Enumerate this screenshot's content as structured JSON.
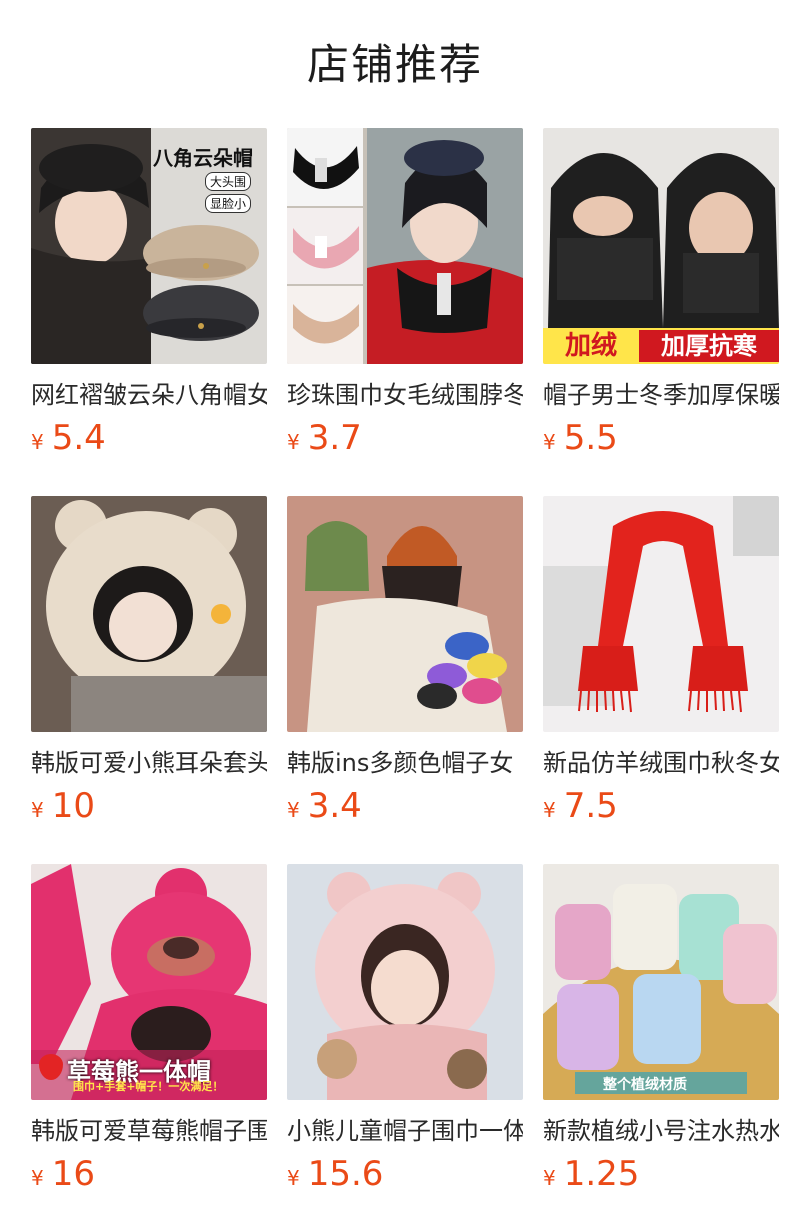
{
  "page": {
    "title": "店铺推荐"
  },
  "currency": "¥",
  "products": [
    {
      "title": "网红褶皱云朵八角帽女",
      "price": "5.4",
      "icon": "beret-hat-image",
      "tags": [
        "八角云朵帽",
        "大头围",
        "显脸小"
      ]
    },
    {
      "title": "珍珠围巾女毛绒围脖冬季",
      "price": "3.7",
      "icon": "pearl-scarf-image"
    },
    {
      "title": "帽子男士冬季加厚保暖",
      "price": "5.5",
      "icon": "balaclava-hat-image",
      "tags": [
        "加绒",
        "加厚抗寒"
      ]
    },
    {
      "title": "韩版可爱小熊耳朵套头帽",
      "price": "10",
      "icon": "bear-ear-hat-image"
    },
    {
      "title": "韩版ins多颜色帽子女",
      "price": "3.4",
      "icon": "knit-beanie-image"
    },
    {
      "title": "新品仿羊绒围巾秋冬女",
      "price": "7.5",
      "icon": "red-scarf-image"
    },
    {
      "title": "韩版可爱草莓熊帽子围巾",
      "price": "16",
      "icon": "strawberry-bear-hat-image",
      "tags": [
        "草莓熊一体帽",
        "围巾+手套+帽子！一次满足！"
      ]
    },
    {
      "title": "小熊儿童帽子围巾一体",
      "price": "15.6",
      "icon": "kids-bear-hat-image"
    },
    {
      "title": "新款植绒小号注水热水袋",
      "price": "1.25",
      "icon": "hot-water-bottle-image",
      "tags": [
        "整个植绒材质"
      ]
    }
  ],
  "colors": {
    "price": "#ea4a17",
    "title": "#2a2a2a"
  }
}
